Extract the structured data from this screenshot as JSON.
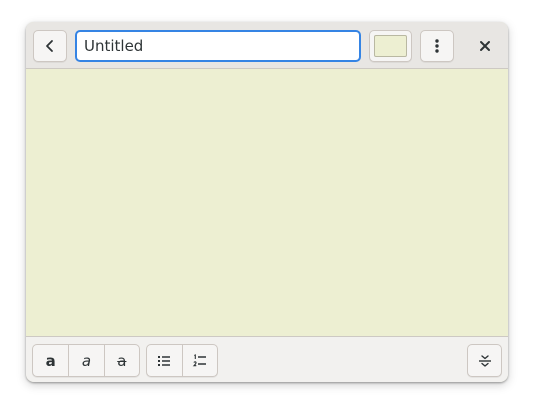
{
  "window": {
    "note_color": "#edefd2"
  },
  "headerbar": {
    "back_icon": "chevron-left-icon",
    "title_value": "Untitled",
    "color_swatch": "#edefd2",
    "menu_icon": "vertical-dots-icon",
    "close_icon": "close-icon"
  },
  "toolbar": {
    "format_buttons": [
      {
        "icon": "bold-icon",
        "glyph": "a"
      },
      {
        "icon": "italic-icon",
        "glyph": "a"
      },
      {
        "icon": "strikethrough-icon",
        "glyph": "a"
      }
    ],
    "list_buttons": [
      {
        "icon": "bullet-list-icon"
      },
      {
        "icon": "numbered-list-icon"
      }
    ],
    "expand_icon": "expand-toolbar-icon"
  },
  "colors": {
    "accent": "#3584e4",
    "headerbar_bg": "#e8e6e3",
    "toolbar_bg": "#f2f1ef"
  }
}
